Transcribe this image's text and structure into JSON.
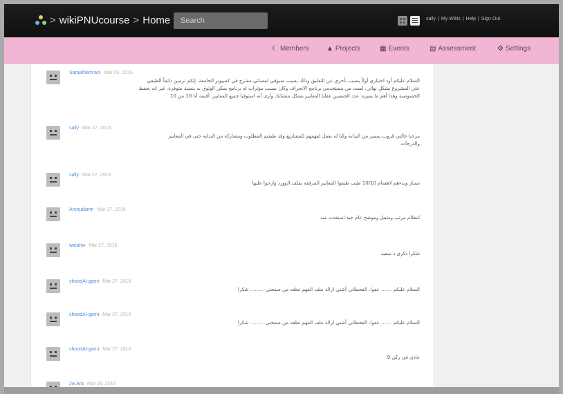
{
  "header": {
    "breadcrumb": {
      "site": "wikiPNUcourse",
      "sep": ">",
      "page": "Home"
    },
    "search_placeholder": "Search",
    "user_links": [
      "sally",
      "My Wikis",
      "Help",
      "Sign Out"
    ],
    "link_sep": "|"
  },
  "nav": {
    "items": [
      {
        "label": "Members",
        "icon": "members-icon"
      },
      {
        "label": "Projects",
        "icon": "projects-icon"
      },
      {
        "label": "Events",
        "icon": "events-icon"
      },
      {
        "label": "Assessment",
        "icon": "assessment-icon"
      },
      {
        "label": "Settings",
        "icon": "settings-icon"
      }
    ]
  },
  "posts": [
    {
      "author": "Saraalhamrani",
      "date": "Mar 26, 2016",
      "lines": [
        "السلام عليكم أود اختياري أولاً بسبب تأخري عن التعليق وذلك بسبب ضيوفي لمسائي مقترح في كمبيوتر الجامعة. إنكم ترمين دائماً الطيفي",
        "على المشروع بشكل نهائي. لست من مستخدمي برنامج الانجراف وكان بسبب مؤثرات له برنامج يمكن الوثوق به بنسبة متوفرة. غير انه يحفظ",
        "الخصوصية وهذا أهم ما يميزه. عدد الجنسين عقلنا المعايير بشكل متشابك وأرى أنه استوفيا جميع المعايير. أقيمه أنا 10 من 10"
      ]
    },
    {
      "author": "sally",
      "date": "Mar 27, 2016",
      "lines": [
        "مرحبا خالتي قروب سمير من البدايه وكنا له يعمل لفهمهم للمشاريع وقد طبقتم المطلوب ومشاركة من البدايه حتى في المعايير",
        "والدرجات"
      ]
    },
    {
      "author": "sally",
      "date": "Mar 27, 2016",
      "lines": [
        "ممتاز وبدءهم لاهتمام 10/10 طيب طبقوا المعايير المرفقة بملف الوورد وارجوا عليها"
      ]
    },
    {
      "author": "Areejalamri",
      "date": "Mar 27, 2016",
      "lines": [
        "انظلام مرتب ومثمل وموضح عام جيد استفدت منه"
      ]
    },
    {
      "author": "walahw",
      "date": "Mar 27, 2016",
      "lines": [
        "شكرا ذكرى ذ سعيه"
      ]
    },
    {
      "author": "shoodAl-garni",
      "date": "Mar 27, 2016",
      "lines": [
        "السلام عليكم ....... عفوا، القحطاني أشتي ازالة ملف الفهم تعلقه من صفحتي ......... شكرا"
      ]
    },
    {
      "author": "shoodAl-garni",
      "date": "Mar 27, 2016",
      "lines": [
        "السلام عليكم ....... عفوا، القحطاني أشتي ازالة ملف الفهم تعلقه من صفحتي ......... شكرا"
      ]
    },
    {
      "author": "shoodAl-garni",
      "date": "Mar 27, 2016",
      "lines": [
        "عادي في ركن 9"
      ]
    },
    {
      "author": "Jw.Ara",
      "date": "Mar 28, 2016",
      "lines": []
    }
  ]
}
